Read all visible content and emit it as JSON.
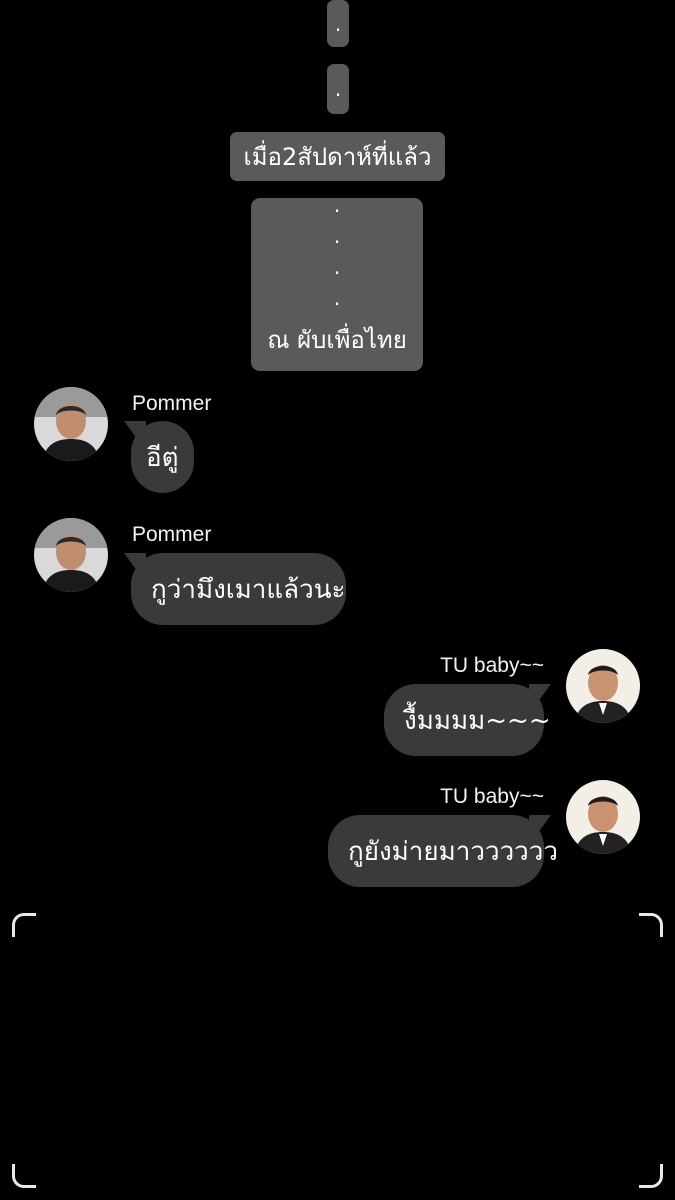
{
  "dots_top": [
    "."
  ],
  "dots_second": [
    "."
  ],
  "date_separator": "เมื่อ2สัปดาห์ที่แล้ว",
  "notice": {
    "dots": [
      ".",
      ".",
      ".",
      "."
    ],
    "text": "ณ ผับเพื่อไทย"
  },
  "messages": [
    {
      "side": "left",
      "sender": "Pommer",
      "text": "อีตู่",
      "avatar": "person-avatar-icon"
    },
    {
      "side": "left",
      "sender": "Pommer",
      "text": "กูว่ามึงเมาแล้วนะ",
      "avatar": "person-avatar-icon"
    },
    {
      "side": "right",
      "sender": "TU baby~~",
      "text": "งื้มมมม~~~",
      "avatar": "person-avatar-icon"
    },
    {
      "side": "right",
      "sender": "TU baby~~",
      "text": "กูยังม่ายมาวววววว",
      "avatar": "person-avatar-icon"
    }
  ],
  "colors": {
    "background": "#000000",
    "system_pill": "#5a5a5a",
    "bubble": "#3a3a3a",
    "text": "#ffffff"
  }
}
